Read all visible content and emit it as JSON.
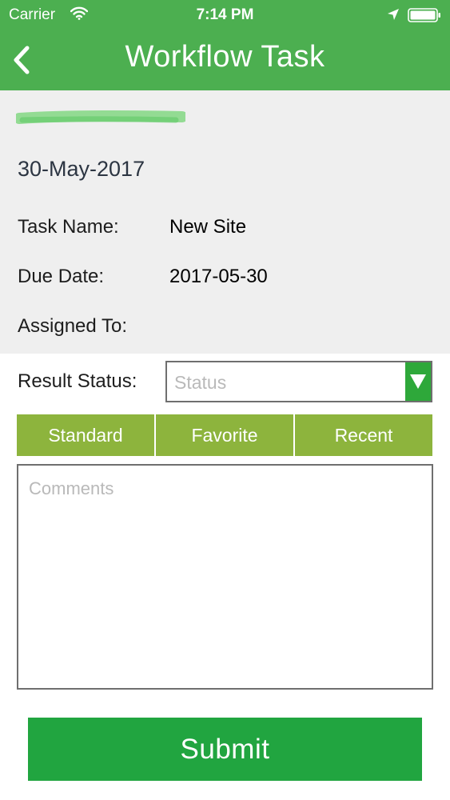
{
  "status_bar": {
    "carrier": "Carrier",
    "time": "7:14 PM",
    "icons": [
      "wifi-icon",
      "location-arrow-icon",
      "battery-icon"
    ]
  },
  "nav": {
    "back_icon": "chevron-left-icon",
    "title": "Workflow Task"
  },
  "task": {
    "date": "30-May-2017",
    "fields": [
      {
        "label": "Task Name:",
        "value": "New Site"
      },
      {
        "label": "Due Date:",
        "value": "2017-05-30"
      },
      {
        "label": "Assigned To:",
        "value": ""
      }
    ]
  },
  "result": {
    "label": "Result Status:",
    "placeholder": "Status",
    "dropdown_icon": "triangle-down-icon"
  },
  "tabs": [
    {
      "label": "Standard"
    },
    {
      "label": "Favorite"
    },
    {
      "label": "Recent"
    }
  ],
  "comments": {
    "placeholder": "Comments"
  },
  "submit": {
    "label": "Submit"
  },
  "colors": {
    "header": "#4caf50",
    "info_background": "#efefef",
    "tab": "#8db43d",
    "dropdown": "#2ea83a",
    "submit": "#21a540"
  }
}
